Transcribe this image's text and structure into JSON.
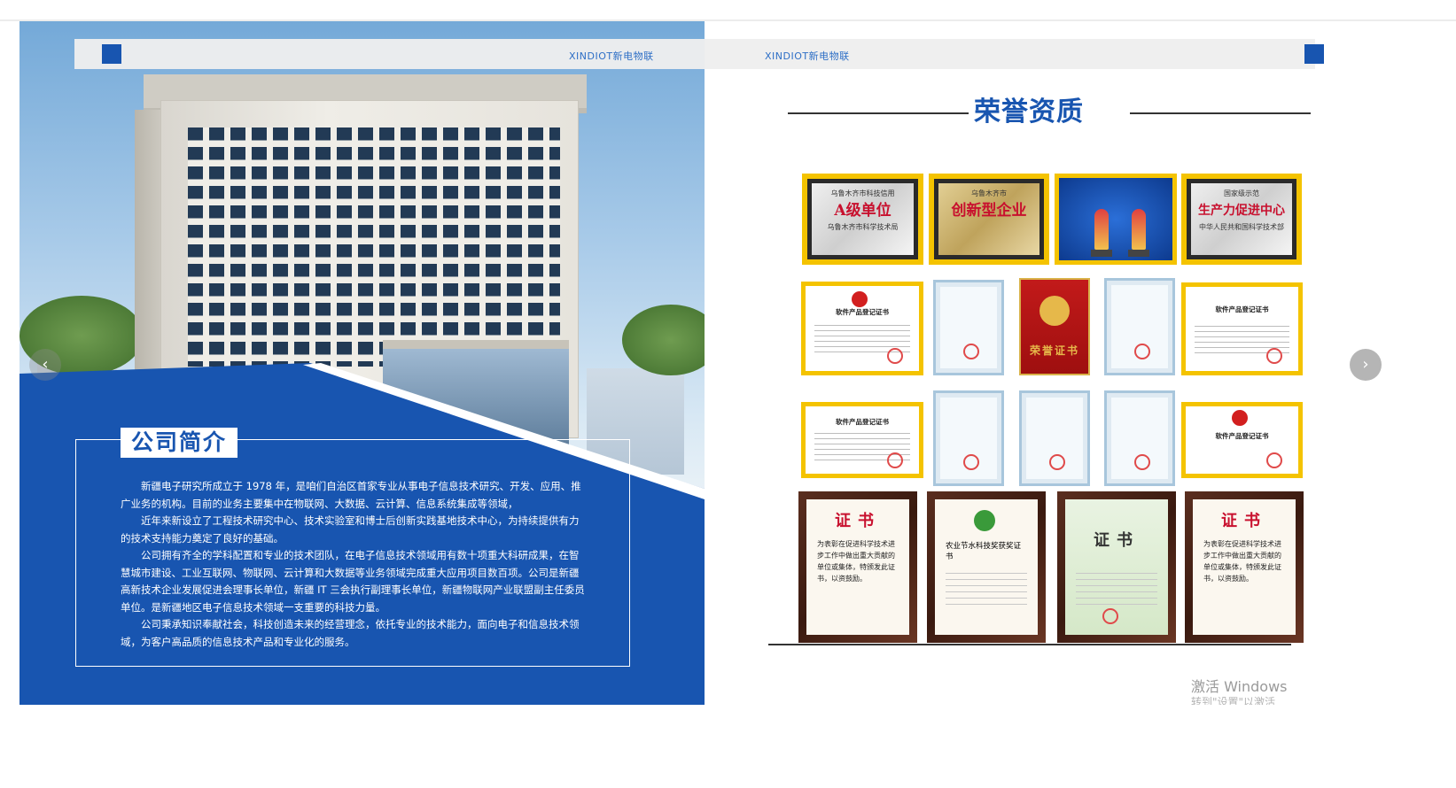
{
  "header": {
    "brand_left": "XINDIOT新电物联",
    "brand_right": "XINDIOT新电物联"
  },
  "company_intro": {
    "heading": "公司简介",
    "paragraphs": [
      "新疆电子研究所成立于 1978 年，是咱们自治区首家专业从事电子信息技术研究、开发、应用、推广业务的机构。目前的业务主要集中在物联网、大数据、云计算、信息系统集成等领域，",
      "近年来新设立了工程技术研究中心、技术实验室和博士后创新实践基地技术中心，为持续提供有力的技术支持能力奠定了良好的基础。",
      "公司拥有齐全的学科配置和专业的技术团队，在电子信息技术领域用有数十项重大科研成果，在智慧城市建设、工业互联网、物联网、云计算和大数据等业务领域完成重大应用项目数百项。公司是新疆高新技术企业发展促进会理事长单位，新疆 IT 三会执行副理事长单位，新疆物联网产业联盟副主任委员单位。是新疆地区电子信息技术领域一支重要的科技力量。",
      "公司秉承知识奉献社会，科技创造未来的经营理念，依托专业的技术能力，面向电子和信息技术领域，为客户高品质的信息技术产品和专业化的服务。"
    ]
  },
  "honors": {
    "title": "荣誉资质",
    "plaques": [
      {
        "top": "乌鲁木齐市科技信用",
        "main": "A级单位",
        "bottom": "乌鲁木齐市科学技术局"
      },
      {
        "top": "乌鲁木齐市",
        "main": "创新型企业",
        "bottom": ""
      },
      {
        "top": "",
        "main": "",
        "bottom": ""
      },
      {
        "top": "国家级示范",
        "main": "生产力促进中心",
        "bottom": "中华人民共和国科学技术部"
      }
    ],
    "software_cert_title": "软件产品登记证书",
    "red_cover_text": "荣誉证书",
    "framed": [
      {
        "title": "证书",
        "body": "为表彰在促进科学技术进步工作中做出重大贡献的单位或集体，特颁发此证书，以资鼓励。"
      },
      {
        "title": "农业节水科技奖获奖证书",
        "body": ""
      },
      {
        "title": "证书",
        "body": ""
      },
      {
        "title": "证书",
        "body": "为表彰在促进科学技术进步工作中做出重大贡献的单位或集体，特颁发此证书，以资鼓励。"
      }
    ]
  },
  "navigation": {
    "prev_symbol": "‹",
    "next_symbol": "›"
  },
  "system_watermark": {
    "line1": "激活 Windows",
    "line2": "转到\"设置\"以激活 Windows。"
  }
}
